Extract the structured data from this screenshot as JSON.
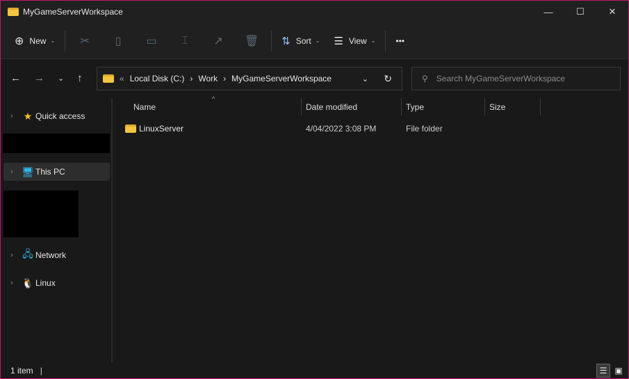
{
  "window": {
    "title": "MyGameServerWorkspace",
    "minimize": "—",
    "maximize": "☐",
    "close": "✕"
  },
  "toolbar": {
    "new_label": "New",
    "sort_label": "Sort",
    "view_label": "View",
    "more": "•••"
  },
  "address": {
    "crumbs": [
      "Local Disk (C:)",
      "Work",
      "MyGameServerWorkspace"
    ],
    "overflow": "«",
    "sep": "›"
  },
  "search": {
    "placeholder": "Search MyGameServerWorkspace"
  },
  "sidebar": {
    "items": [
      {
        "label": "Quick access"
      },
      {
        "label": "This PC"
      },
      {
        "label": "Network"
      },
      {
        "label": "Linux"
      }
    ]
  },
  "columns": {
    "name": "Name",
    "date": "Date modified",
    "type": "Type",
    "size": "Size"
  },
  "files": [
    {
      "name": "LinuxServer",
      "date": "4/04/2022 3:08 PM",
      "type": "File folder",
      "size": ""
    }
  ],
  "status": {
    "count": "1 item"
  }
}
